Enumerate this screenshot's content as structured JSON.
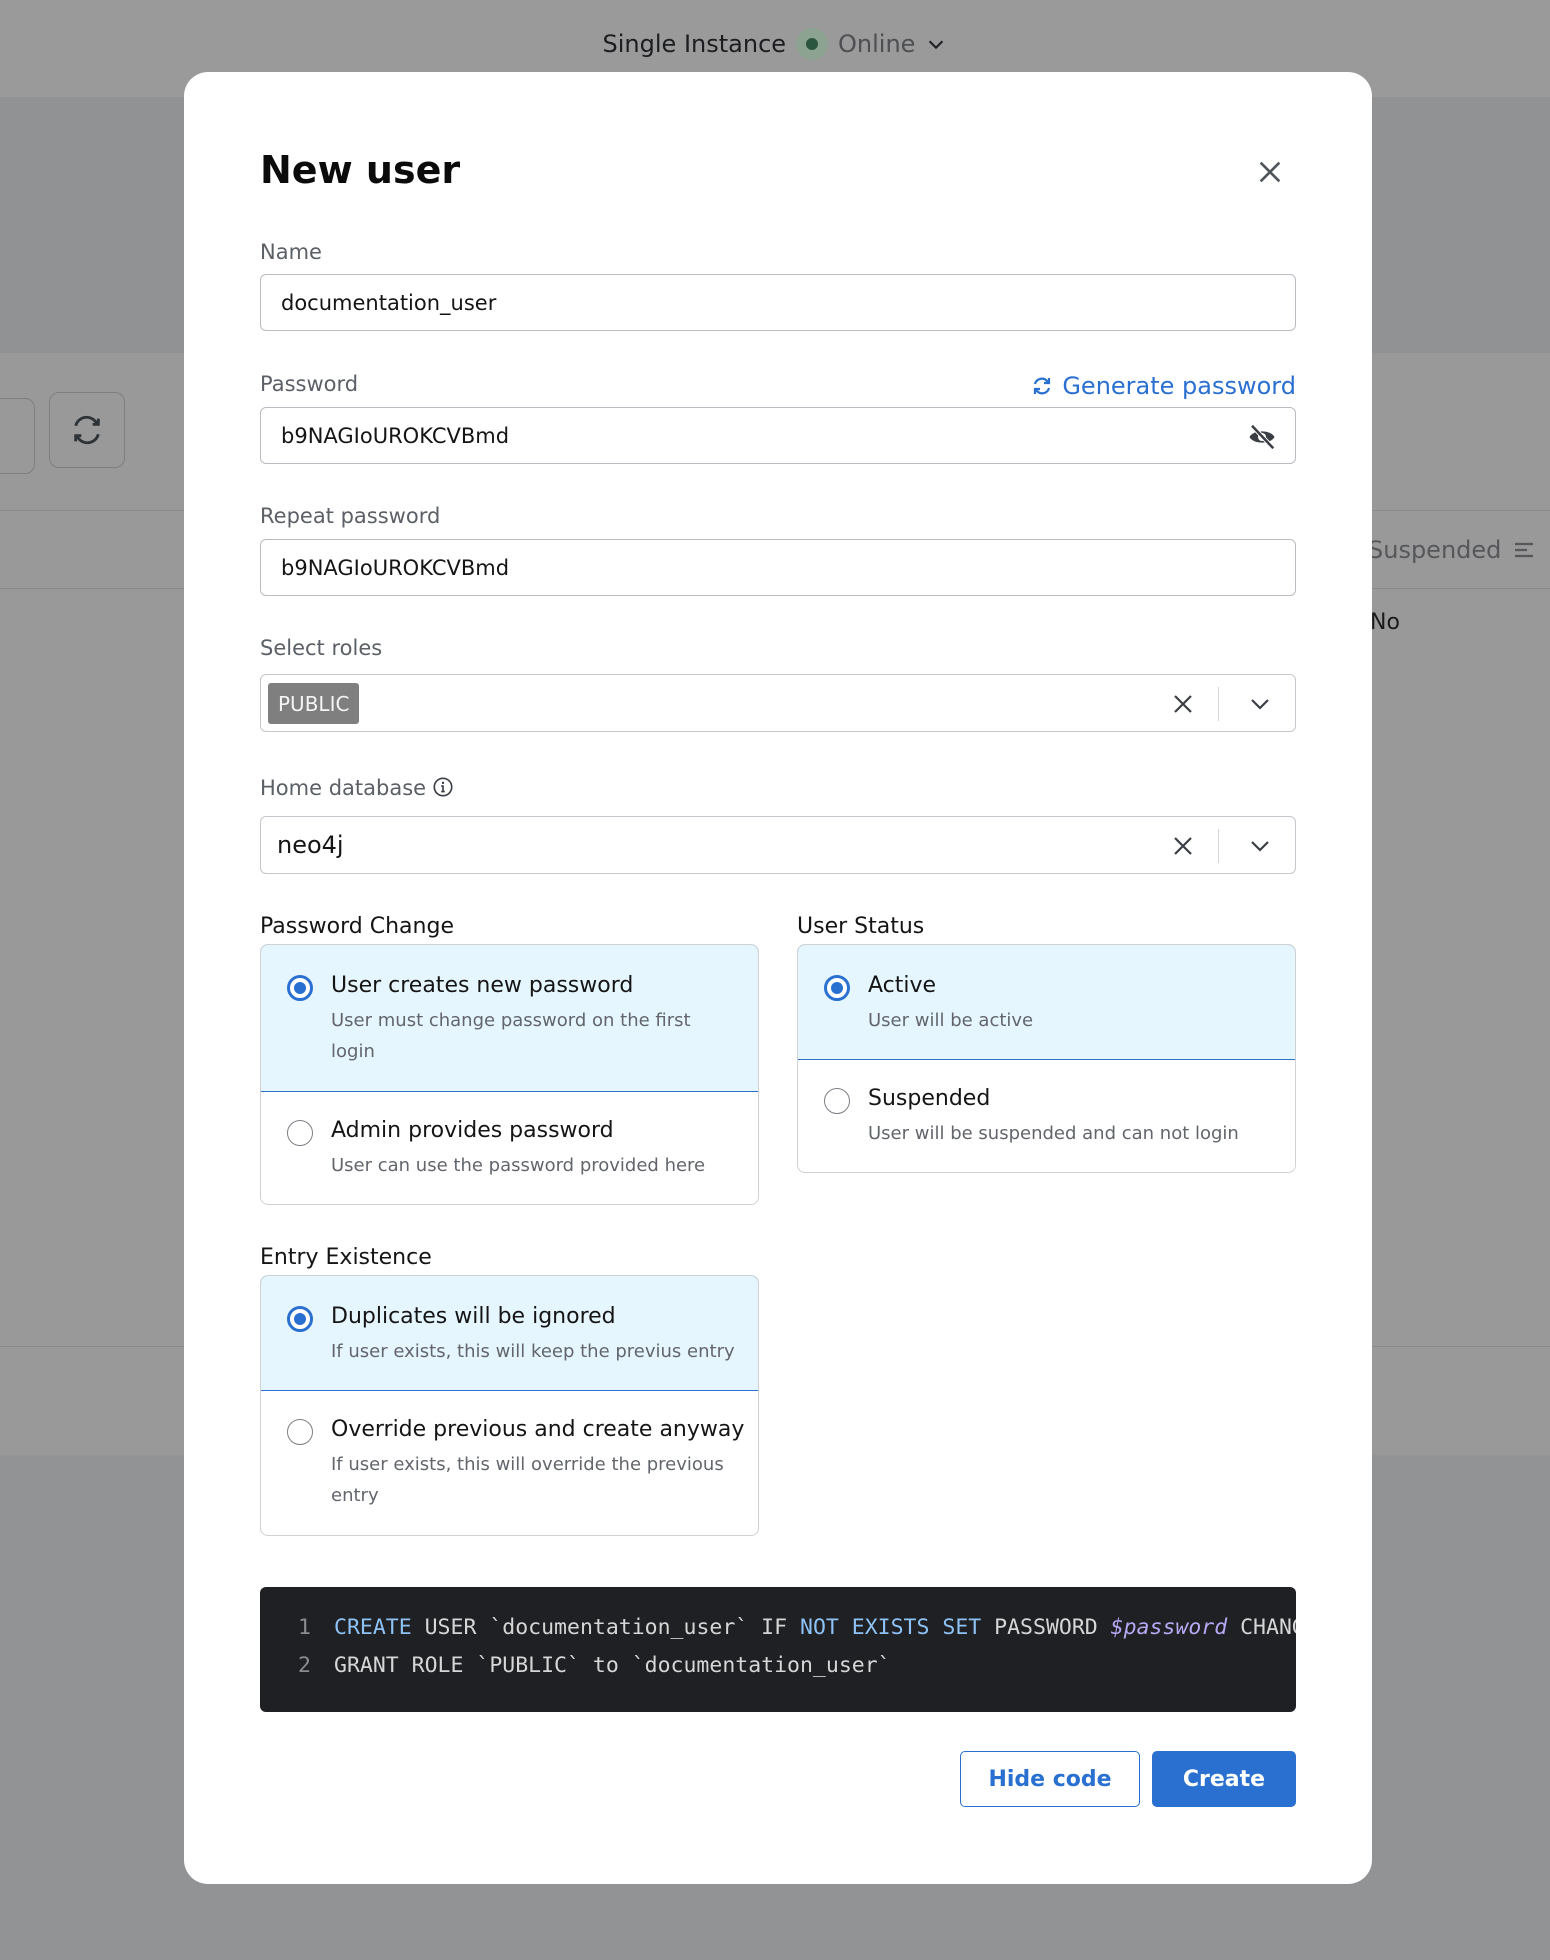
{
  "background": {
    "instance_name": "Single Instance",
    "instance_status": "Online",
    "table_column": "Suspended",
    "table_cell": "No"
  },
  "modal": {
    "title": "New user",
    "name": {
      "label": "Name",
      "value": "documentation_user"
    },
    "password": {
      "label": "Password",
      "value": "b9NAGIoUROKCVBmd",
      "generate_label": "Generate password"
    },
    "repeat_password": {
      "label": "Repeat password",
      "value": "b9NAGIoUROKCVBmd"
    },
    "roles": {
      "label": "Select roles",
      "selected": [
        "PUBLIC"
      ]
    },
    "home_database": {
      "label": "Home database",
      "value": "neo4j"
    },
    "password_change": {
      "label": "Password Change",
      "options": [
        {
          "title": "User creates new password",
          "desc": "User must change password on the first login",
          "selected": true
        },
        {
          "title": "Admin provides password",
          "desc": "User can use the password provided here",
          "selected": false
        }
      ]
    },
    "user_status": {
      "label": "User Status",
      "options": [
        {
          "title": "Active",
          "desc": "User will be active",
          "selected": true
        },
        {
          "title": "Suspended",
          "desc": "User will be suspended and can not login",
          "selected": false
        }
      ]
    },
    "entry_existence": {
      "label": "Entry Existence",
      "options": [
        {
          "title": "Duplicates will be ignored",
          "desc": "If user exists, this will keep the previus entry",
          "selected": true
        },
        {
          "title": "Override previous and create anyway",
          "desc": "If user exists, this will override the previous entry",
          "selected": false
        }
      ]
    },
    "code": {
      "lines": [
        {
          "n": "1",
          "tokens": [
            {
              "t": "CREATE",
              "c": "kw"
            },
            {
              "t": " USER `documentation_user` IF ",
              "c": ""
            },
            {
              "t": "NOT EXISTS SET",
              "c": "kw"
            },
            {
              "t": " PASSWORD ",
              "c": ""
            },
            {
              "t": "$password",
              "c": "var"
            },
            {
              "t": " CHANGE REQUIRED",
              "c": ""
            }
          ]
        },
        {
          "n": "2",
          "tokens": [
            {
              "t": "GRANT ROLE `PUBLIC` to `documentation_user`",
              "c": ""
            }
          ]
        }
      ]
    },
    "buttons": {
      "hide_code": "Hide code",
      "create": "Create"
    }
  },
  "colors": {
    "accent": "#2a70d0",
    "selected_bg": "#e6f6fe",
    "code_bg": "#1f2023",
    "status_dot": "#2a5640"
  }
}
